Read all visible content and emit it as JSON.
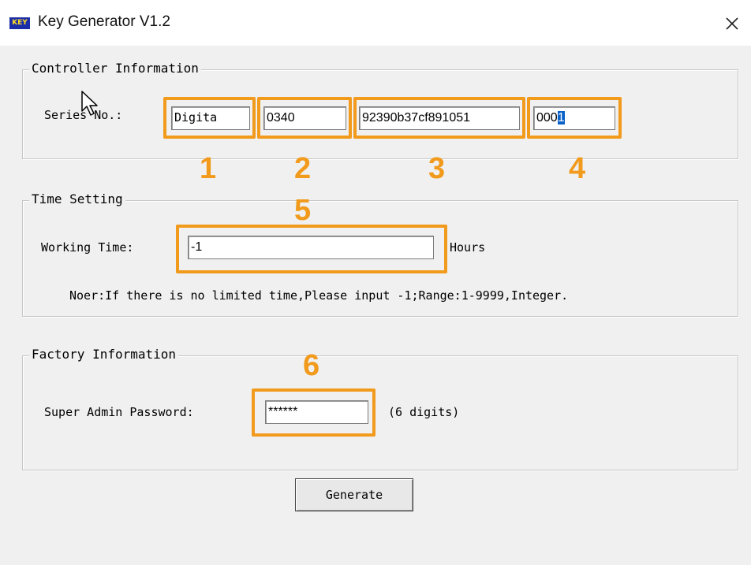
{
  "window": {
    "icon_text": "KEY",
    "title": "Key Generator V1.2"
  },
  "controller": {
    "legend": "Controller Information",
    "serial_label": "Series No.:",
    "field1": "Digita",
    "field2": "0340",
    "field3": "92390b37cf891051",
    "field4_plain": "000",
    "field4_selected": "1"
  },
  "time": {
    "legend": "Time Setting",
    "working_label": "Working Time:",
    "working_value": "-1",
    "unit": "Hours",
    "note": "Noer:If there is no limited time,Please input -1;Range:1-9999,Integer."
  },
  "factory": {
    "legend": "Factory Information",
    "password_label": "Super Admin Password:",
    "password_value": "******",
    "hint": "(6 digits)"
  },
  "actions": {
    "generate": "Generate"
  },
  "markers": [
    "1",
    "2",
    "3",
    "4",
    "5",
    "6"
  ],
  "colors": {
    "highlight": "#f19a1c",
    "selection": "#0a62c9",
    "dialog_bg": "#f0f0f0"
  }
}
